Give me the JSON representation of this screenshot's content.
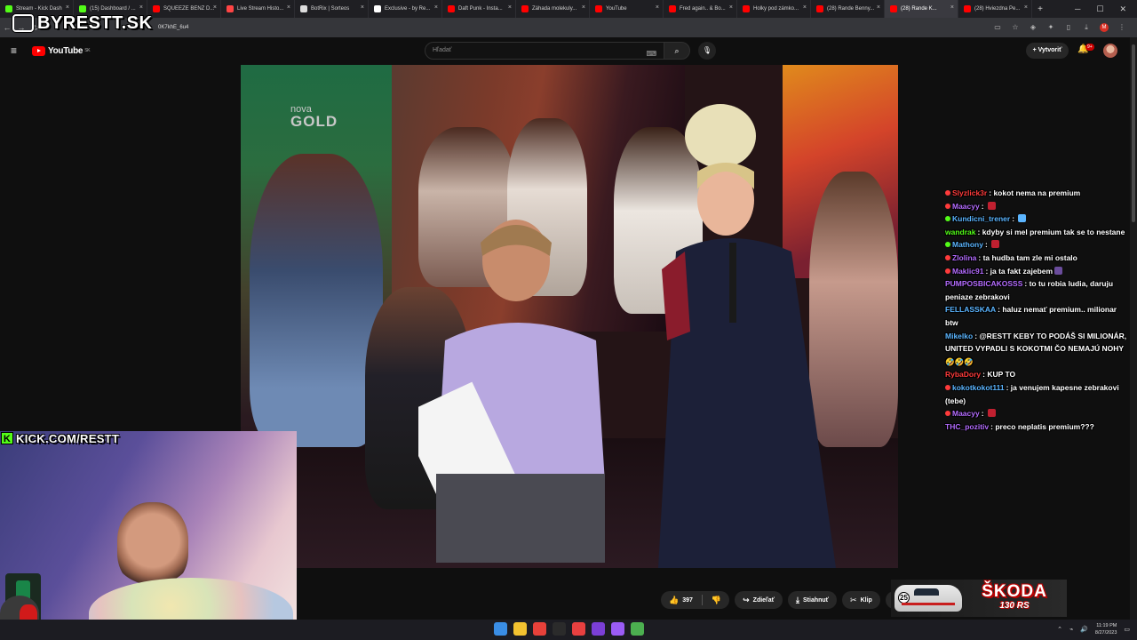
{
  "browser": {
    "tabs": [
      {
        "label": "Stream - Kick Dash",
        "color": "#53fc18"
      },
      {
        "label": "(15) Dashboard / ...",
        "color": "#53fc18"
      },
      {
        "label": "SQUEEZE BENZ D...",
        "color": "#ff0000"
      },
      {
        "label": "Live Stream Histo...",
        "color": "#ff4444"
      },
      {
        "label": "BotRix | Sorteos",
        "color": "#dddddd"
      },
      {
        "label": "Exclusive - by Re...",
        "color": "#ffffff"
      },
      {
        "label": "Daft Punk - Insta...",
        "color": "#ff0000"
      },
      {
        "label": "Záhada molekuly...",
        "color": "#ff0000"
      },
      {
        "label": "YouTube",
        "color": "#ff0000"
      },
      {
        "label": "Fred again.. & Bo...",
        "color": "#ff0000"
      },
      {
        "label": "Holky pod zámko...",
        "color": "#ff0000"
      },
      {
        "label": "(28) Rande Benny...",
        "color": "#ff0000"
      },
      {
        "label": "(28) Rande K...",
        "color": "#ff0000",
        "active": true
      },
      {
        "label": "(28) Hviezdna Pe...",
        "color": "#ff0000"
      }
    ],
    "url_fragment": "0K7khE_6u4"
  },
  "brand_overlay": "BYRESTT.SK",
  "youtube": {
    "logo_text": "YouTube",
    "region": "SK",
    "search_placeholder": "Hľadať",
    "create_label": "Vytvoriť",
    "notif_count": "9+"
  },
  "video": {
    "channel_bug_line1": "nova",
    "channel_bug_line2": "GOLD"
  },
  "chat": [
    {
      "user": "Slyzlick3r",
      "user_color": "#ff3b3b",
      "text": "kokot nema na premium",
      "badge": "#ff3b3b"
    },
    {
      "user": "Maacyy",
      "user_color": "#b46cff",
      "text": "",
      "badge": "#ff3b3b",
      "emote": "#c02030"
    },
    {
      "user": "Kundicni_trener",
      "user_color": "#5bb5ff",
      "text": "",
      "badge": "#53fc18",
      "emote": "#5bb5ff"
    },
    {
      "user": "wandrak",
      "user_color": "#53fc18",
      "text": "kdyby si mel premium tak se to nestane"
    },
    {
      "user": "Mathony",
      "user_color": "#5bb5ff",
      "text": "",
      "badge": "#53fc18",
      "emote": "#c02030"
    },
    {
      "user": "Zlolina",
      "user_color": "#b46cff",
      "text": "ta hudba tam zle mi ostalo",
      "badge": "#ff3b3b"
    },
    {
      "user": "Maklic91",
      "user_color": "#b46cff",
      "text": "ja ta fakt zajebem",
      "badge": "#ff3b3b",
      "emote": "#6a4c9c"
    },
    {
      "user": "PUMPOSBICAKOSSS",
      "user_color": "#b46cff",
      "text": "to tu robia ludia, daruju peniaze zebrakovi"
    },
    {
      "user": "FELLASSKAA",
      "user_color": "#5bb5ff",
      "text": "haluz nemať premium.. milionar btw"
    },
    {
      "user": "Mikelko",
      "user_color": "#5bb5ff",
      "text": "@RESTT KEBY TO PODÁŠ SI MILIONÁR, UNITED VYPADLI S KOKOTMI ČO NEMAJÚ NOHY 🤣🤣🤣"
    },
    {
      "user": "RybaDory",
      "user_color": "#ff3b3b",
      "text": "KUP TO"
    },
    {
      "user": "kokotkokot111",
      "user_color": "#5bb5ff",
      "text": "ja venujem kapesne zebrakovi (tebe)",
      "badge": "#ff3b3b"
    },
    {
      "user": "Maacyy",
      "user_color": "#b46cff",
      "text": "",
      "badge": "#ff3b3b",
      "emote": "#c02030"
    },
    {
      "user": "THC_pozitiv",
      "user_color": "#b46cff",
      "text": "preco neplatis premium???"
    }
  ],
  "kick_overlay": "KICK.COM/RESTT",
  "actions": {
    "like_count": "397",
    "share_label": "Zdieľať",
    "download_label": "Stiahnuť",
    "clip_label": "Klip",
    "more_label": "···"
  },
  "sponsor": {
    "brand": "ŠKODA",
    "model": "130 RS",
    "car_number": "25"
  },
  "taskbar": {
    "time": "11:19 PM",
    "date": "8/27/2023",
    "app_colors": [
      "#3a8ee6",
      "#f2c230",
      "#e8413a",
      "#2b2b2b",
      "#e84040",
      "#7b3fd6",
      "#9b5cf6",
      "#4caf50"
    ]
  }
}
